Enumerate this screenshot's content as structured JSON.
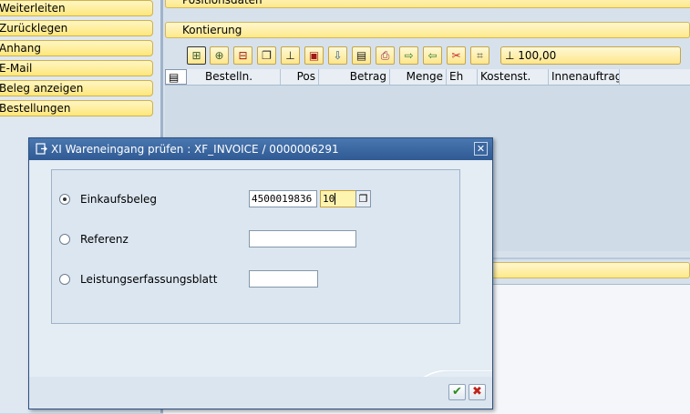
{
  "left_actions": [
    "Weiterleiten",
    "Zurücklegen",
    "Anhang",
    "E-Mail",
    "Beleg anzeigen",
    "Bestellungen"
  ],
  "trays": {
    "positions_label": "Positionsdaten",
    "assignment_label": "Kontierung",
    "lower_label": ""
  },
  "toolbar": {
    "icons": [
      "insert-row-icon",
      "add-row-icon",
      "delete-row-icon",
      "copy-icon",
      "sum-icon",
      "save-icon",
      "import-icon",
      "document-icon",
      "print-icon",
      "export-icon",
      "layout-icon",
      "clear-icon",
      "filter-icon"
    ],
    "sum_value": "100,00"
  },
  "grid": {
    "columns": [
      "Bestelln.",
      "Pos",
      "Betrag",
      "Menge",
      "Eh",
      "Kostenst.",
      "Innenauftrag"
    ]
  },
  "dialog": {
    "title": "XI Wareneingang prüfen : XF_INVOICE / 0000006291",
    "close_symbol": "✕",
    "options": [
      {
        "label": "Einkaufsbeleg",
        "selected": true,
        "value": "4500019836",
        "value2": "10"
      },
      {
        "label": "Referenz",
        "selected": false,
        "value": ""
      },
      {
        "label": "Leistungserfassungsblatt",
        "selected": false,
        "value": ""
      }
    ],
    "confirm_symbol": "✔",
    "cancel_symbol": "✖",
    "colors": {
      "title_bar": "#3a66a0",
      "confirm": "#2e8b1e",
      "cancel": "#c0241a"
    }
  }
}
